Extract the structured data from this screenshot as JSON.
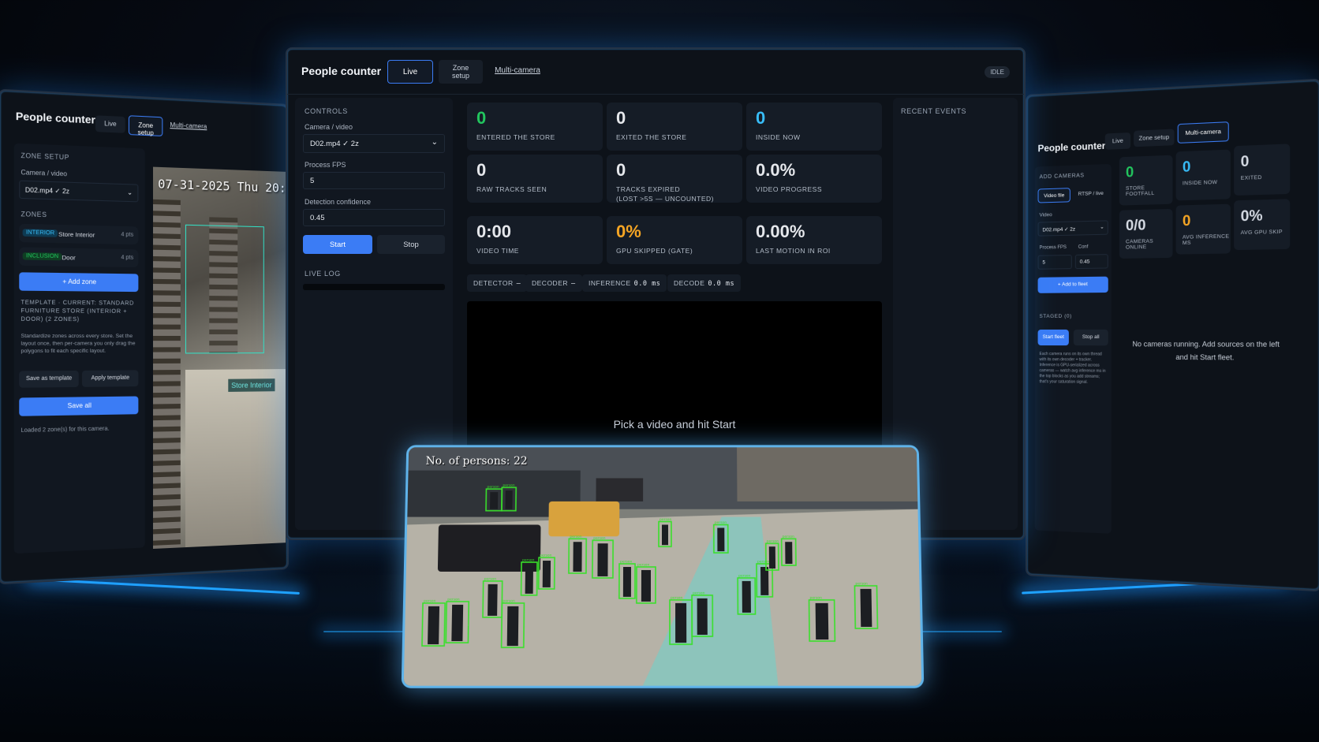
{
  "center": {
    "title": "People counter",
    "tabs": [
      {
        "label": "Live"
      },
      {
        "label_line1": "Zone",
        "label_line2": "setup"
      },
      {
        "label": "Multi-camera"
      }
    ],
    "status": "IDLE",
    "controls": {
      "heading": "CONTROLS",
      "camera_label": "Camera / video",
      "camera_value": "D02.mp4 ✓ 2z",
      "fps_label": "Process FPS",
      "fps_value": "5",
      "conf_label": "Detection confidence",
      "conf_value": "0.45",
      "start": "Start",
      "stop": "Stop",
      "log_heading": "LIVE LOG"
    },
    "stats": [
      {
        "value": "0",
        "label": "ENTERED THE STORE",
        "color": "#22c55e"
      },
      {
        "value": "0",
        "label": "EXITED THE STORE",
        "color": "#e5e7eb"
      },
      {
        "value": "0",
        "label": "INSIDE NOW",
        "color": "#38bdf8"
      },
      {
        "value": "0",
        "label": "RAW TRACKS SEEN",
        "color": "#e5e7eb"
      },
      {
        "value": "0",
        "label": "TRACKS EXPIRED",
        "label2": "(LOST >5S — UNCOUNTED)",
        "color": "#e5e7eb"
      },
      {
        "value": "0.0%",
        "label": "VIDEO PROGRESS",
        "color": "#e5e7eb"
      },
      {
        "value": "0:00",
        "label": "VIDEO TIME",
        "color": "#e5e7eb"
      },
      {
        "value": "0%",
        "label": "GPU SKIPPED (GATE)",
        "color": "#f5a524"
      },
      {
        "value": "0.00%",
        "label": "LAST MOTION IN ROI",
        "color": "#e5e7eb"
      }
    ],
    "chips": [
      {
        "label": "DETECTOR",
        "value": "–"
      },
      {
        "label": "DECODER",
        "value": "–"
      },
      {
        "label": "INFERENCE",
        "value": "0.0 ms"
      },
      {
        "label": "DECODE",
        "value": "0.0 ms"
      }
    ],
    "video_message": "Pick a video and hit Start",
    "events_heading": "RECENT EVENTS"
  },
  "left": {
    "title": "People counter",
    "tabs": [
      {
        "label": "Live"
      },
      {
        "label": "Zone setup"
      },
      {
        "label": "Multi-camera"
      }
    ],
    "zone_setup_heading": "ZONE SETUP",
    "camera_label": "Camera / video",
    "camera_value": "D02.mp4 ✓ 2z",
    "zones_heading": "ZONES",
    "zones": [
      {
        "tag": "INTERIOR",
        "name": "Store Interior",
        "pts": "4 pts",
        "tag_color": "#38bdf8"
      },
      {
        "tag": "INCLUSION",
        "name": "Door",
        "pts": "4 pts",
        "tag_color": "#22c55e"
      }
    ],
    "add_zone": "+ Add zone",
    "template_heading": "TEMPLATE · CURRENT: STANDARD FURNITURE STORE (INTERIOR + DOOR) (2 ZONES)",
    "template_desc": "Standardize zones across every store. Set the layout once, then per-camera you only drag the polygons to fit each specific layout.",
    "save_template": "Save as template",
    "apply_template": "Apply template",
    "save_all": "Save all",
    "loaded_msg": "Loaded 2 zone(s) for this camera.",
    "cctv_timestamp": "07-31-2025 Thu 20:57:23",
    "cctv_zone": "Store Interior"
  },
  "right": {
    "title": "People counter",
    "tabs": [
      {
        "label": "Live"
      },
      {
        "label": "Zone setup"
      },
      {
        "label": "Multi-camera"
      }
    ],
    "add_cameras": "ADD CAMERAS",
    "source_tabs": [
      {
        "label": "Video file"
      },
      {
        "label": "RTSP / live"
      }
    ],
    "video_label": "Video",
    "video_value": "D02.mp4 ✓ 2z",
    "fps_label": "Process FPS",
    "fps_value": "5",
    "conf_label": "Conf",
    "conf_value": "0.45",
    "add_to_fleet": "+ Add to fleet",
    "staged": "STAGED (0)",
    "start_fleet": "Start fleet",
    "stop_all": "Stop all",
    "fleet_note": "Each camera runs on its own thread with its own decoder + tracker. Inference is GPU-serialized across cameras — watch avg inference ms in the top blocks as you add streams; that's your saturation signal.",
    "stats": [
      {
        "value": "0",
        "label": "STORE FOOTFALL",
        "color": "#22c55e"
      },
      {
        "value": "0",
        "label": "INSIDE NOW",
        "color": "#38bdf8"
      },
      {
        "value": "0",
        "label": "EXITED",
        "color": "#e5e7eb"
      },
      {
        "value": "0/0",
        "label": "CAMERAS ONLINE",
        "color": "#e5e7eb"
      },
      {
        "value": "0",
        "label": "AVG INFERENCE MS",
        "color": "#f5a524"
      },
      {
        "value": "0%",
        "label": "AVG GPU SKIP",
        "color": "#e5e7eb"
      }
    ],
    "empty_msg_1": "No cameras running. Add sources on the left",
    "empty_msg_2": "and hit Start fleet."
  },
  "tablet": {
    "overlay": "No. of persons: 22",
    "box_label": "person"
  }
}
